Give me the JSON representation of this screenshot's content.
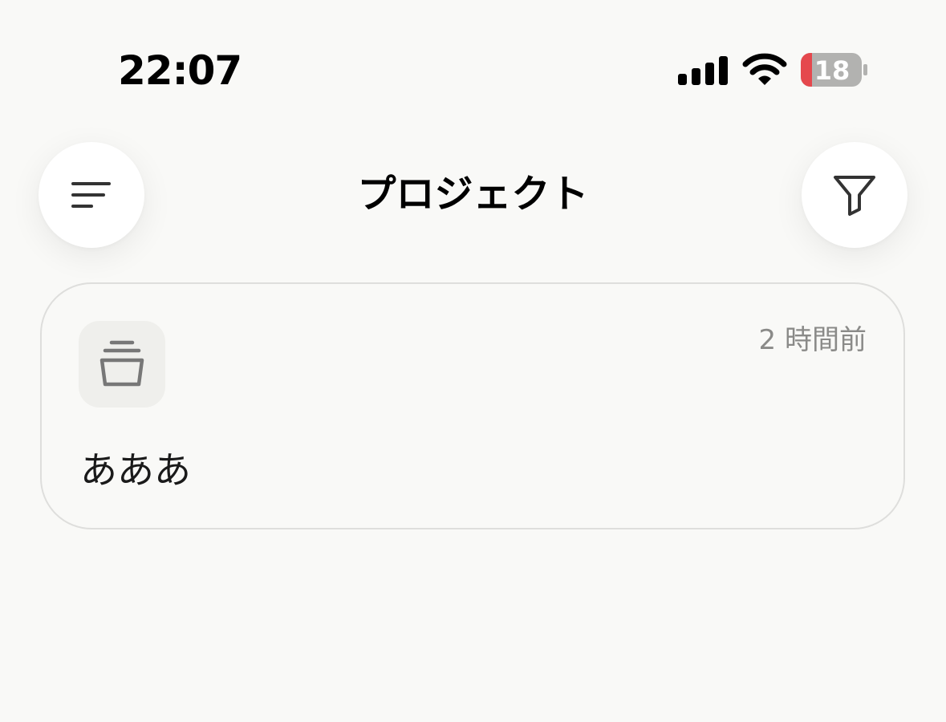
{
  "status_bar": {
    "time": "22:07",
    "battery_level": "18",
    "icons": [
      "cellular-signal-icon",
      "wifi-icon",
      "battery-icon"
    ]
  },
  "header": {
    "title": "プロジェクト",
    "left_button_icon": "menu-lines-icon",
    "right_button_icon": "filter-funnel-icon"
  },
  "projects": [
    {
      "name": "あああ",
      "updated": "2 時間前",
      "icon": "archive-tray-icon"
    }
  ],
  "colors": {
    "background": "#f9f9f7",
    "battery_low": "#e5484d",
    "muted_text": "#8a8a88",
    "card_border": "#dededc"
  }
}
